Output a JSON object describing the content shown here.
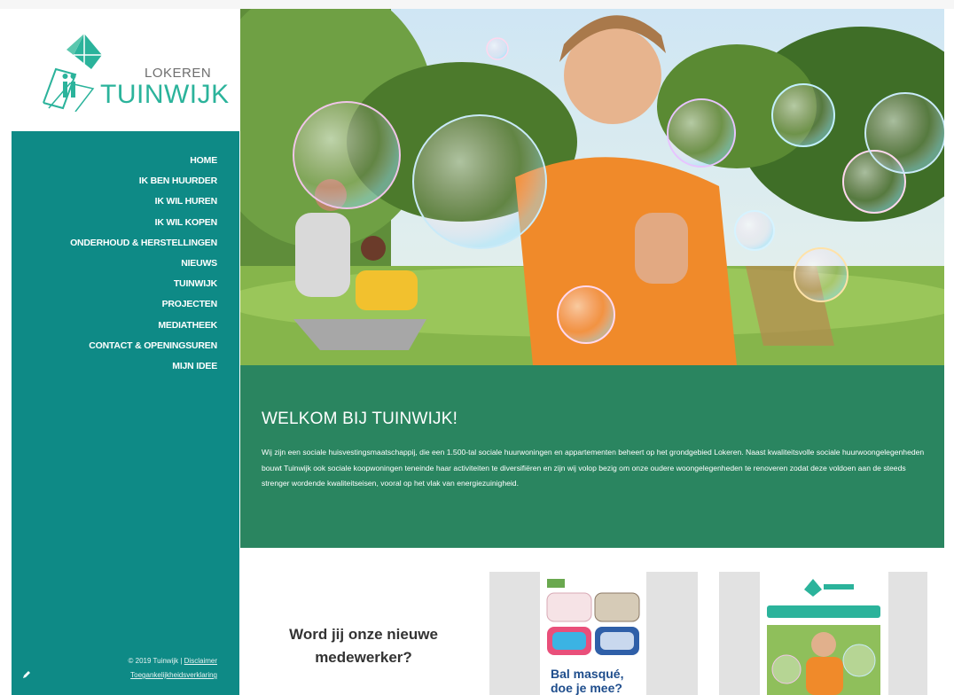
{
  "colors": {
    "sidebar_bg": "#0e8a86",
    "welcome_bg": "#2a8560",
    "brand_green": "#2bb39b"
  },
  "logo": {
    "small": "LOKEREN",
    "big": "TUINWIJK",
    "icon": "house-logo-icon"
  },
  "nav": {
    "items": [
      {
        "label": "HOME"
      },
      {
        "label": "IK BEN HUURDER"
      },
      {
        "label": "IK WIL HUREN"
      },
      {
        "label": "IK WIL KOPEN"
      },
      {
        "label": "ONDERHOUD & HERSTELLINGEN"
      },
      {
        "label": "NIEUWS"
      },
      {
        "label": "TUINWIJK"
      },
      {
        "label": "PROJECTEN"
      },
      {
        "label": "MEDIATHEEK"
      },
      {
        "label": "CONTACT & OPENINGSUREN"
      },
      {
        "label": "MIJN IDEE"
      }
    ]
  },
  "footer": {
    "copyright": "© 2019 Tuinwijk |",
    "disclaimer": "Disclaimer",
    "accessibility": "Toegankelijkheidsverklaring",
    "icon": "edit-icon"
  },
  "welcome": {
    "title": "WELKOM BIJ TUINWIJK!",
    "body": "Wij zijn een sociale huisvestingsmaatschappij, die een 1.500-tal sociale huurwoningen en appartementen beheert op het grondgebied Lokeren. Naast kwaliteitsvolle sociale huurwoongelegenheden bouwt Tuinwijk ook sociale koopwoningen teneinde haar activiteiten te diversifiëren en zijn wij volop bezig om onze oudere woongelegenheden te renoveren zodat deze voldoen aan de steeds strenger wordende kwaliteitseisen, vooral op het vlak van energiezuinigheid."
  },
  "cards": {
    "job": {
      "line1": "Word jij onze nieuwe",
      "line2": "medewerker?"
    },
    "masks": {
      "title_line1": "Bal masqué,",
      "title_line2": "doe je mee?"
    }
  }
}
